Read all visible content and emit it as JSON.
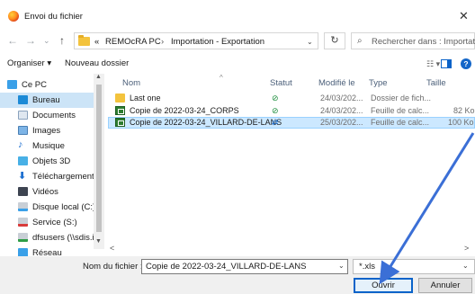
{
  "window": {
    "title": "Envoi du fichier",
    "close": "✕"
  },
  "nav": {
    "back": "←",
    "forward": "→",
    "recent": "⌄",
    "up": "↑"
  },
  "breadcrumb": {
    "overflow": "«",
    "parts": [
      "REMOcRA PC",
      "Importation - Exportation"
    ],
    "separator": "›",
    "dropdown": "⌄",
    "refresh": "↻"
  },
  "search": {
    "placeholder": "Rechercher dans : Importati..."
  },
  "toolbar": {
    "organize": "Organiser ▾",
    "new_folder": "Nouveau dossier",
    "view_icon": "☷ ▾",
    "help": "?"
  },
  "sidebar": {
    "items": [
      {
        "label": "Ce PC",
        "icon": "pc-icon"
      },
      {
        "label": "Bureau",
        "icon": "desktop-icon",
        "selected": true
      },
      {
        "label": "Documents",
        "icon": "documents-icon"
      },
      {
        "label": "Images",
        "icon": "images-icon"
      },
      {
        "label": "Musique",
        "icon": "music-icon"
      },
      {
        "label": "Objets 3D",
        "icon": "objects3d-icon"
      },
      {
        "label": "Téléchargements",
        "icon": "downloads-icon"
      },
      {
        "label": "Vidéos",
        "icon": "videos-icon"
      },
      {
        "label": "Disque local (C:)",
        "icon": "drive-icon"
      },
      {
        "label": "Service (S:)",
        "icon": "network-drive-icon"
      },
      {
        "label": "dfsusers (\\\\sdis.i",
        "icon": "network-drive-icon"
      },
      {
        "label": "Réseau",
        "icon": "network-icon"
      }
    ]
  },
  "columns": {
    "name": "Nom",
    "status": "Statut",
    "modified": "Modifié le",
    "type": "Type",
    "size": "Taille"
  },
  "files": [
    {
      "name": "Last one",
      "status": "ok",
      "modified": "24/03/202...",
      "type": "Dossier de fich...",
      "size": "",
      "kind": "folder"
    },
    {
      "name": "Copie de 2022-03-24_CORPS",
      "status": "ok",
      "modified": "24/03/202...",
      "type": "Feuille de calc...",
      "size": "82 Ko",
      "kind": "calc"
    },
    {
      "name": "Copie de 2022-03-24_VILLARD-DE-LANS",
      "status": "sync",
      "modified": "25/03/202...",
      "type": "Feuille de calc...",
      "size": "100 Ko",
      "kind": "calc",
      "selected": true
    }
  ],
  "status_glyphs": {
    "ok": "⊘",
    "sync": "⇄"
  },
  "footer": {
    "filename_label": "Nom du fichier :",
    "filename_value": "Copie de 2022-03-24_VILLARD-DE-LANS",
    "filter_value": "*.xls",
    "open_button": "Ouvrir",
    "cancel_button": "Annuler"
  },
  "colors": {
    "accent": "#0a63c9",
    "selection": "#cce8ff",
    "annotation_arrow": "#3b6fd6"
  }
}
